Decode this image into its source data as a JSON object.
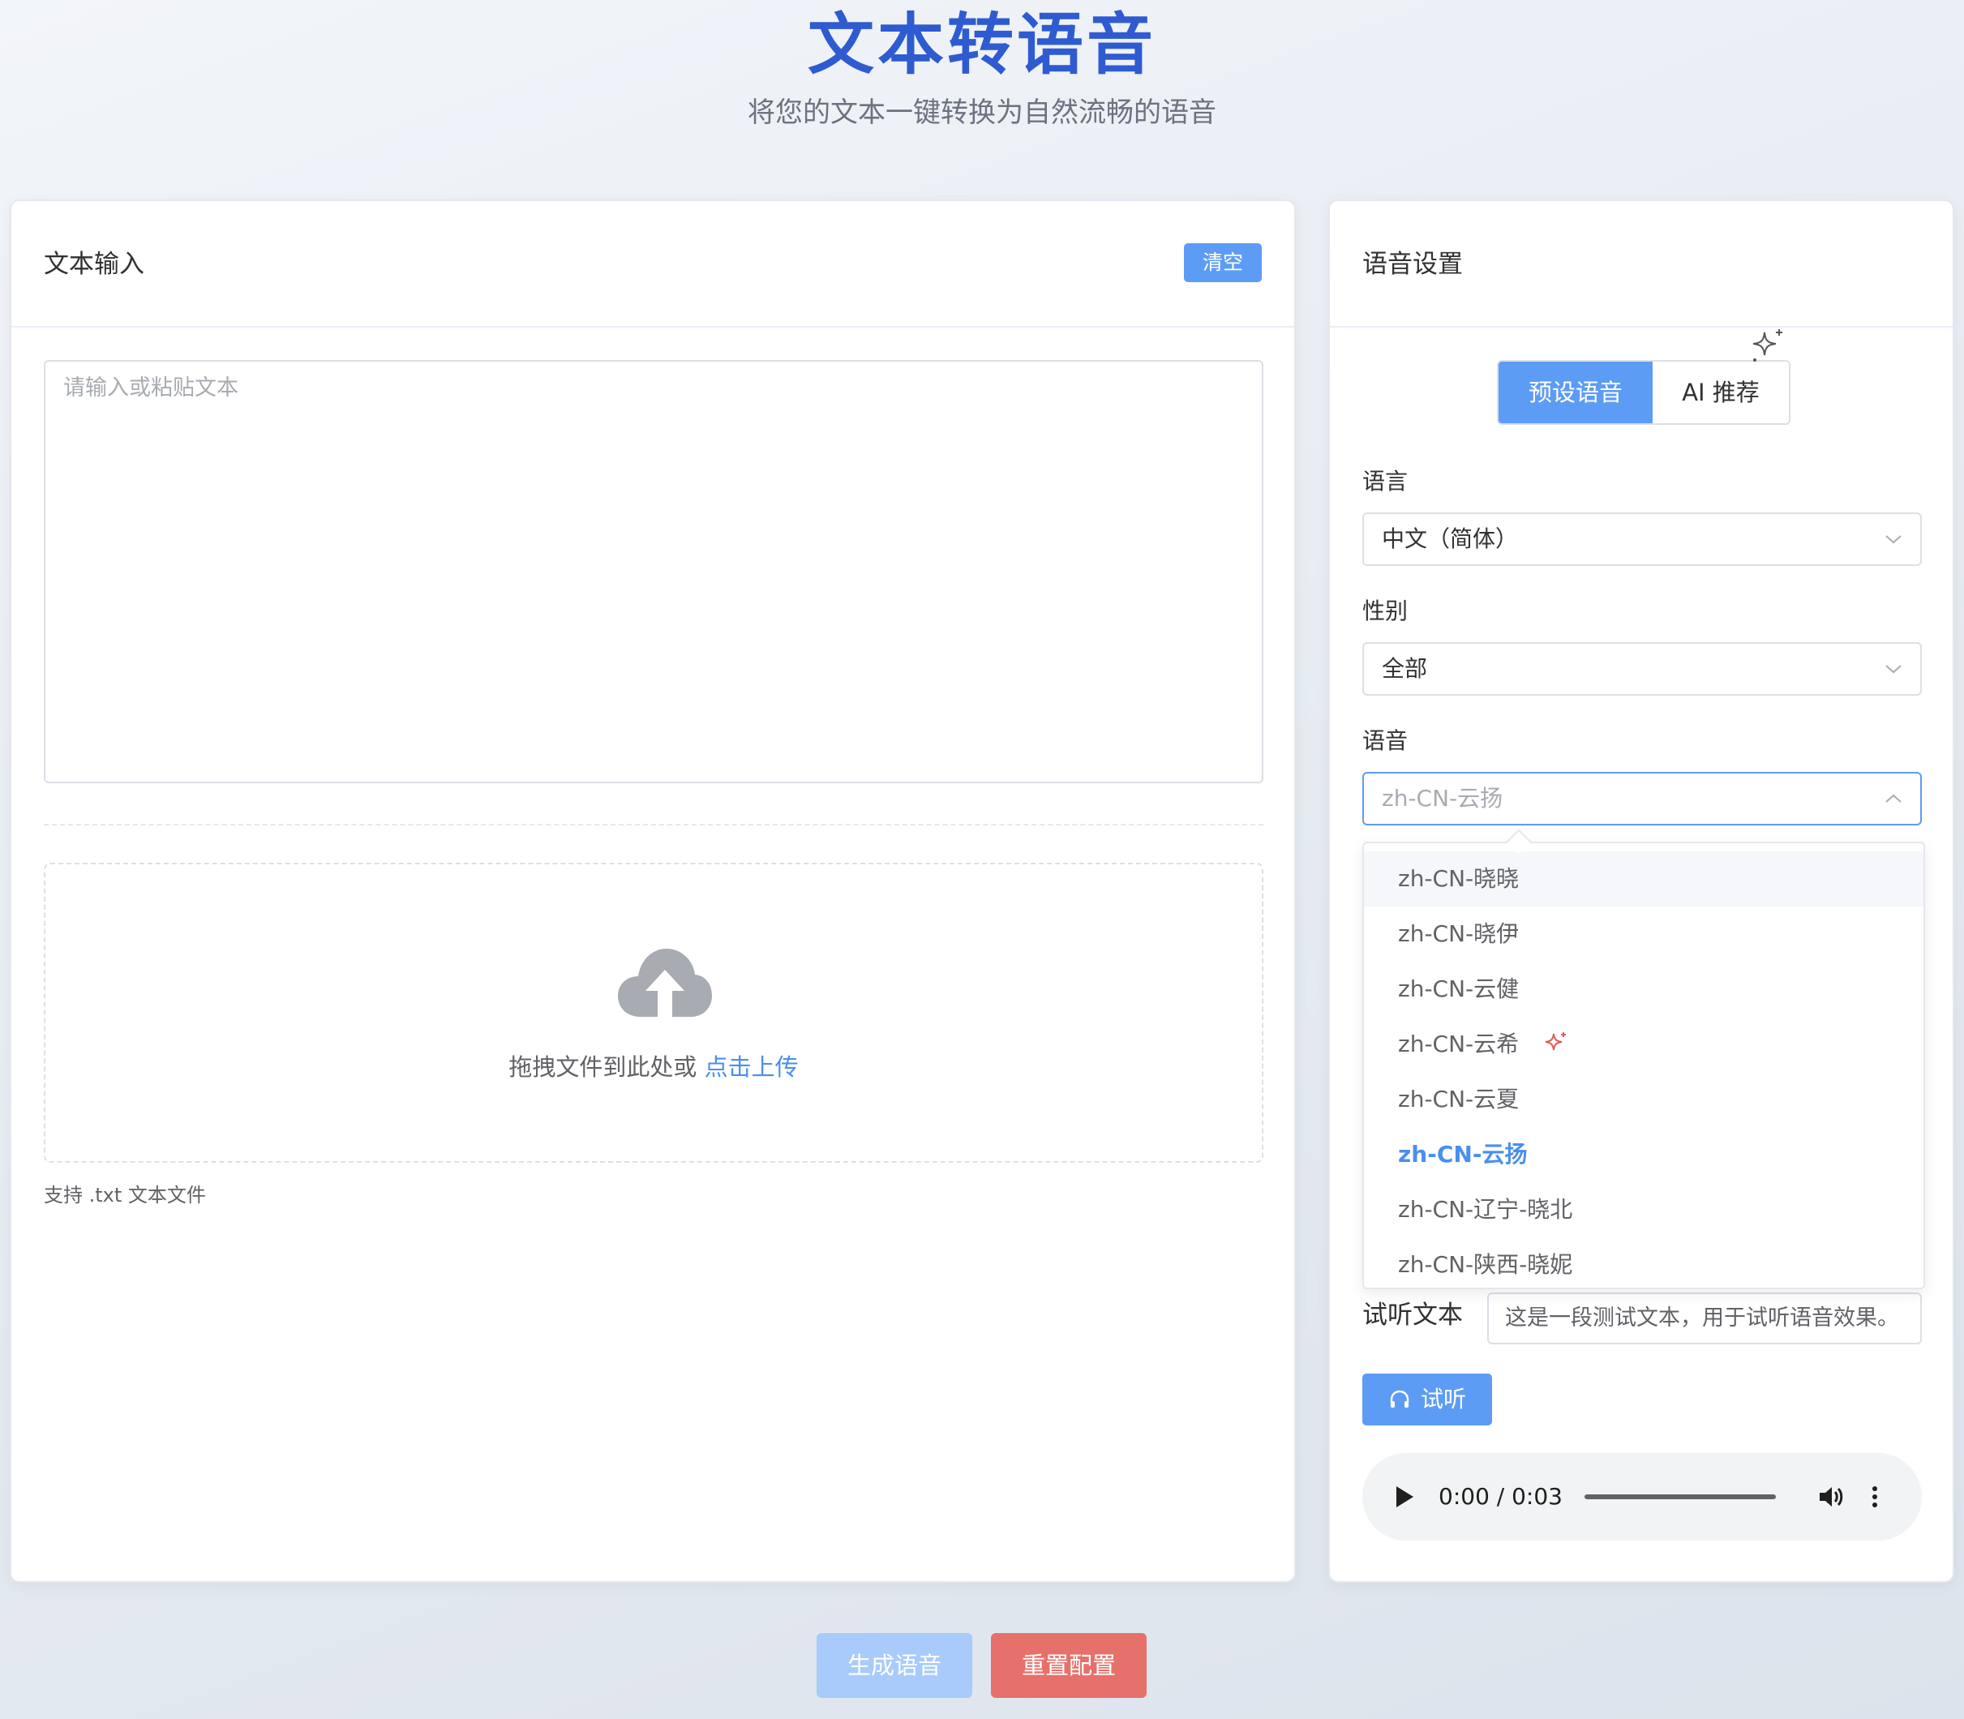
{
  "header": {
    "title": "文本转语音",
    "subtitle": "将您的文本一键转换为自然流畅的语音"
  },
  "text_panel": {
    "title": "文本输入",
    "clear_label": "清空",
    "textarea_placeholder": "请输入或粘贴文本",
    "upload": {
      "icon": "cloud-upload-icon",
      "prompt": "拖拽文件到此处或 ",
      "link": "点击上传",
      "hint": "支持 .txt 文本文件"
    }
  },
  "voice_panel": {
    "title": "语音设置",
    "tabs": [
      {
        "label": "预设语音",
        "active": true
      },
      {
        "label": "AI 推荐",
        "active": false,
        "icon": "sparkle-icon"
      }
    ],
    "language": {
      "label": "语言",
      "value": "中文（简体）"
    },
    "gender": {
      "label": "性别",
      "value": "全部"
    },
    "voice": {
      "label": "语音",
      "placeholder": "zh-CN-云扬",
      "options": [
        {
          "label": "zh-CN-晓晓",
          "state": "hover"
        },
        {
          "label": "zh-CN-晓伊"
        },
        {
          "label": "zh-CN-云健"
        },
        {
          "label": "zh-CN-云希",
          "icon": "sparkle-icon"
        },
        {
          "label": "zh-CN-云夏"
        },
        {
          "label": "zh-CN-云扬",
          "state": "selected"
        },
        {
          "label": "zh-CN-辽宁-晓北"
        },
        {
          "label": "zh-CN-陕西-晓妮"
        }
      ]
    },
    "preview": {
      "label": "试听文本",
      "value": "这是一段测试文本，用于试听语音效果。",
      "button_label": "试听",
      "button_icon": "headphones-icon"
    },
    "audio": {
      "time": "0:00 / 0:03"
    }
  },
  "actions": {
    "generate_label": "生成语音",
    "reset_label": "重置配置"
  },
  "colors": {
    "accent": "#5d9cf5",
    "title": "#2f5bd0",
    "danger": "#e6716b",
    "link": "#4a8ef0"
  }
}
